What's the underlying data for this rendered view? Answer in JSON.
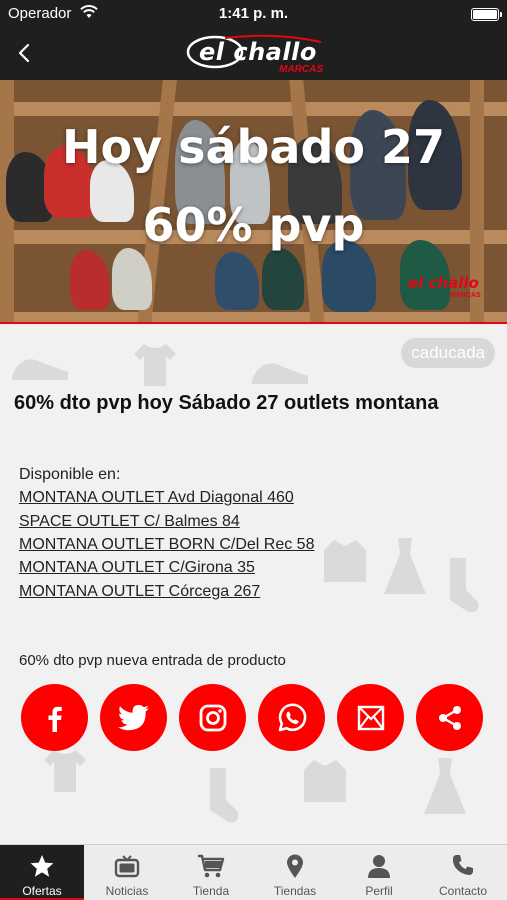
{
  "status_bar": {
    "carrier": "Operador",
    "time": "1:41 p. m."
  },
  "header": {
    "logo_text": "el challo",
    "logo_sub": "MARCAS"
  },
  "hero": {
    "line1": "Hoy sábado 27",
    "line2": "60% pvp",
    "watermark": "el challo",
    "watermark_sub": "MARCAS"
  },
  "offer": {
    "status_badge": "caducada",
    "title": "60% dto pvp hoy Sábado 27 outlets montana",
    "available_label": "Disponible en:",
    "stores": [
      "MONTANA OUTLET Avd Diagonal 460",
      "SPACE OUTLET C/ Balmes 84",
      "MONTANA OUTLET BORN C/Del Rec 58",
      "MONTANA OUTLET C/Girona 35",
      "MONTANA OUTLET Córcega 267"
    ],
    "description": "60% dto pvp nueva entrada de producto"
  },
  "share_buttons": [
    "facebook-icon",
    "twitter-icon",
    "instagram-icon",
    "whatsapp-icon",
    "email-icon",
    "share-icon"
  ],
  "tabs": [
    {
      "label": "Ofertas",
      "icon": "star-icon"
    },
    {
      "label": "Noticias",
      "icon": "tv-icon"
    },
    {
      "label": "Tienda",
      "icon": "cart-icon"
    },
    {
      "label": "Tiendas",
      "icon": "location-pin-icon"
    },
    {
      "label": "Perfil",
      "icon": "user-icon"
    },
    {
      "label": "Contacto",
      "icon": "phone-icon"
    }
  ],
  "colors": {
    "brand_red": "#e30613",
    "share_red": "#ff0000",
    "bar_dark": "#1f1f1f",
    "badge_gray": "#d8d8d8"
  }
}
